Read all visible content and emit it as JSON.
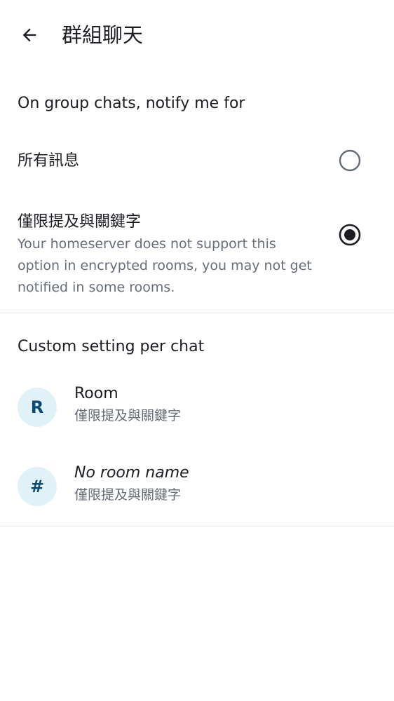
{
  "header": {
    "title": "群組聊天",
    "back_icon": "arrow-left-icon"
  },
  "notify_section": {
    "header": "On group chats, notify me for",
    "options": [
      {
        "label": "所有訊息",
        "description": "",
        "selected": false
      },
      {
        "label": "僅限提及與關鍵字",
        "description": "Your homeserver does not support this option in encrypted rooms, you may not get notified in some rooms.",
        "selected": true
      }
    ]
  },
  "custom_section": {
    "header": "Custom setting per chat",
    "rooms": [
      {
        "avatar_letter": "R",
        "name": "Room",
        "italic": false,
        "setting": "僅限提及與關鍵字"
      },
      {
        "avatar_letter": "#",
        "name": "No room name",
        "italic": true,
        "setting": "僅限提及與關鍵字"
      }
    ]
  },
  "colors": {
    "text_primary": "#1b1d22",
    "text_secondary": "#656d77",
    "radio_unselected": "#656d77",
    "radio_selected": "#1b1d22",
    "avatar_bg": "#e0f2f7",
    "avatar_fg": "#0a4a73",
    "divider": "#e3e6ea"
  }
}
